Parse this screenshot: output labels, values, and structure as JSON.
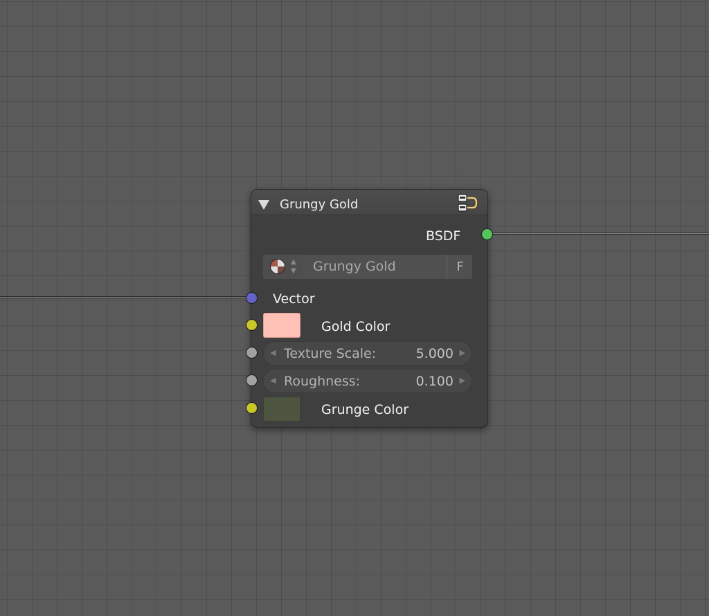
{
  "node": {
    "title": "Grungy Gold",
    "group_icon": "node-group-icon",
    "collapse_icon": "collapse-triangle-icon",
    "output": {
      "label": "BSDF",
      "socket_color": "#55c45a"
    },
    "selector": {
      "icon": "material-ball-icon",
      "name": "Grungy Gold",
      "fake_user_label": "F"
    },
    "inputs": {
      "vector": {
        "label": "Vector",
        "socket_color": "#6363c7"
      },
      "gold_color": {
        "label": "Gold Color",
        "socket_color": "#c7c729",
        "swatch_color": "#ffc1b5"
      },
      "texture_scale": {
        "label": "Texture Scale:",
        "value": "5.000",
        "socket_color": "#a1a1a1"
      },
      "roughness": {
        "label": "Roughness:",
        "value": "0.100",
        "socket_color": "#a1a1a1"
      },
      "grunge_color": {
        "label": "Grunge Color",
        "socket_color": "#c7c729",
        "swatch_color": "#4d5540"
      }
    }
  }
}
